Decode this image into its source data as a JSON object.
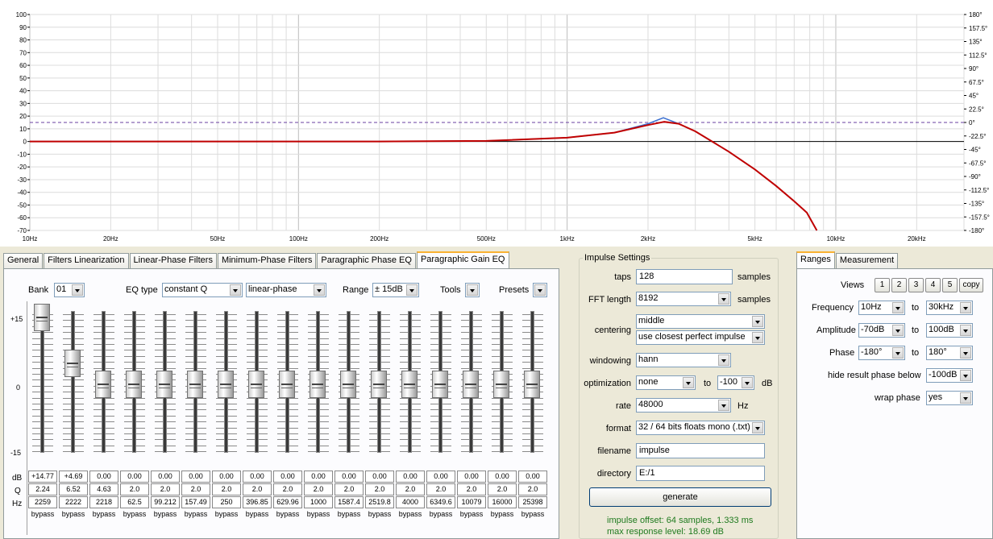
{
  "plot": {
    "y_left_ticks": [
      "100",
      "90",
      "80",
      "70",
      "60",
      "50",
      "40",
      "30",
      "20",
      "10",
      "0",
      "-10",
      "-20",
      "-30",
      "-40",
      "-50",
      "-60",
      "-70"
    ],
    "y_right_ticks": [
      "180°",
      "157.5°",
      "135°",
      "112.5°",
      "90°",
      "67.5°",
      "45°",
      "22.5°",
      "0°",
      "-22.5°",
      "-45°",
      "-67.5°",
      "-90°",
      "-112.5°",
      "-135°",
      "-157.5°",
      "-180°"
    ],
    "x_ticks": [
      {
        "label": "10Hz",
        "f": 10
      },
      {
        "label": "20Hz",
        "f": 20
      },
      {
        "label": "50Hz",
        "f": 50
      },
      {
        "label": "100Hz",
        "f": 100
      },
      {
        "label": "200Hz",
        "f": 200
      },
      {
        "label": "500Hz",
        "f": 500
      },
      {
        "label": "1kHz",
        "f": 1000
      },
      {
        "label": "2kHz",
        "f": 2000
      },
      {
        "label": "5kHz",
        "f": 5000
      },
      {
        "label": "10kHz",
        "f": 10000
      },
      {
        "label": "20kHz",
        "f": 20000
      }
    ],
    "colors": {
      "red": "#c00000",
      "blue": "#3a6fd0",
      "dash": "#6a3fa0"
    }
  },
  "chart_data": {
    "type": "line",
    "xlabel": "",
    "ylabel": "",
    "xlim_hz": [
      10,
      30000
    ],
    "ylim_db": [
      -70,
      100
    ],
    "x_scale": "log",
    "phase_range_deg": [
      -180,
      180
    ],
    "series": [
      {
        "name": "",
        "color": "#c00000",
        "points": [
          [
            10,
            0
          ],
          [
            200,
            0
          ],
          [
            500,
            0.5
          ],
          [
            1000,
            3
          ],
          [
            1500,
            7
          ],
          [
            2000,
            13
          ],
          [
            2300,
            15.5
          ],
          [
            2600,
            14
          ],
          [
            3000,
            8
          ],
          [
            4000,
            -8
          ],
          [
            5000,
            -22
          ],
          [
            6000,
            -35
          ],
          [
            7000,
            -47
          ],
          [
            7800,
            -56
          ],
          [
            8500,
            -70
          ]
        ]
      },
      {
        "name": "",
        "color": "#3a6fd0",
        "points": [
          [
            10,
            0
          ],
          [
            200,
            0
          ],
          [
            500,
            0.5
          ],
          [
            1000,
            3
          ],
          [
            1500,
            7
          ],
          [
            2000,
            14
          ],
          [
            2280,
            18.7
          ],
          [
            2600,
            14
          ],
          [
            3000,
            8
          ],
          [
            4000,
            -8
          ],
          [
            5000,
            -22
          ],
          [
            6000,
            -35
          ],
          [
            7000,
            -47
          ],
          [
            7800,
            -56
          ],
          [
            8500,
            -70
          ]
        ]
      }
    ],
    "reference_lines": [
      {
        "y_db": 0,
        "style": "solid",
        "color": "#000000"
      },
      {
        "y_db": 15,
        "style": "dashed",
        "color": "#6a3fa0"
      }
    ]
  },
  "left_tabs": [
    "General",
    "Filters Linearization",
    "Linear-Phase Filters",
    "Minimum-Phase Filters",
    "Paragraphic Phase EQ",
    "Paragraphic Gain EQ"
  ],
  "eq": {
    "bank_label": "Bank",
    "bank_value": "01",
    "eqtype_label": "EQ type",
    "eqtype_value": "constant Q",
    "phase_value": "linear-phase",
    "range_label": "Range",
    "range_value": "± 15dB",
    "tools_label": "Tools",
    "presets_label": "Presets",
    "scale_top": "+15",
    "scale_mid": "0",
    "scale_bot": "-15",
    "row_db": "dB",
    "row_q": "Q",
    "row_hz": "Hz",
    "bands": [
      {
        "db": "+14.77",
        "q": "2.24",
        "hz": "2259",
        "bypass": "bypass",
        "level": 14.77
      },
      {
        "db": "+4.69",
        "q": "6.52",
        "hz": "2222",
        "bypass": "bypass",
        "level": 4.69
      },
      {
        "db": "0.00",
        "q": "4.63",
        "hz": "2218",
        "bypass": "bypass",
        "level": 0
      },
      {
        "db": "0.00",
        "q": "2.0",
        "hz": "62.5",
        "bypass": "bypass",
        "level": 0
      },
      {
        "db": "0.00",
        "q": "2.0",
        "hz": "99.212",
        "bypass": "bypass",
        "level": 0
      },
      {
        "db": "0.00",
        "q": "2.0",
        "hz": "157.49",
        "bypass": "bypass",
        "level": 0
      },
      {
        "db": "0.00",
        "q": "2.0",
        "hz": "250",
        "bypass": "bypass",
        "level": 0
      },
      {
        "db": "0.00",
        "q": "2.0",
        "hz": "396.85",
        "bypass": "bypass",
        "level": 0
      },
      {
        "db": "0.00",
        "q": "2.0",
        "hz": "629.96",
        "bypass": "bypass",
        "level": 0
      },
      {
        "db": "0.00",
        "q": "2.0",
        "hz": "1000",
        "bypass": "bypass",
        "level": 0
      },
      {
        "db": "0.00",
        "q": "2.0",
        "hz": "1587.4",
        "bypass": "bypass",
        "level": 0
      },
      {
        "db": "0.00",
        "q": "2.0",
        "hz": "2519.8",
        "bypass": "bypass",
        "level": 0
      },
      {
        "db": "0.00",
        "q": "2.0",
        "hz": "4000",
        "bypass": "bypass",
        "level": 0
      },
      {
        "db": "0.00",
        "q": "2.0",
        "hz": "6349.6",
        "bypass": "bypass",
        "level": 0
      },
      {
        "db": "0.00",
        "q": "2.0",
        "hz": "10079",
        "bypass": "bypass",
        "level": 0
      },
      {
        "db": "0.00",
        "q": "2.0",
        "hz": "16000",
        "bypass": "bypass",
        "level": 0
      },
      {
        "db": "0.00",
        "q": "2.0",
        "hz": "25398",
        "bypass": "bypass",
        "level": 0
      }
    ]
  },
  "impulse": {
    "title": "Impulse Settings",
    "taps_label": "taps",
    "taps_value": "128",
    "taps_unit": "samples",
    "fft_label": "FFT length",
    "fft_value": "8192",
    "fft_unit": "samples",
    "centering_label": "centering",
    "centering_value": "middle",
    "centering_value2": "use closest perfect impulse",
    "windowing_label": "windowing",
    "windowing_value": "hann",
    "optimization_label": "optimization",
    "optimization_value": "none",
    "to_label": "to",
    "opt_to_value": "-100",
    "opt_unit": "dB",
    "rate_label": "rate",
    "rate_value": "48000",
    "rate_unit": "Hz",
    "format_label": "format",
    "format_value": "32 / 64 bits floats mono (.txt)",
    "filename_label": "filename",
    "filename_value": "impulse",
    "directory_label": "directory",
    "directory_value": "E:/1",
    "generate_label": "generate",
    "status_offset": "impulse offset: 64 samples, 1.333 ms",
    "status_level": "max response level: 18.69 dB"
  },
  "ranges": {
    "tabs": [
      "Ranges",
      "Measurement"
    ],
    "views_label": "Views",
    "views": [
      "1",
      "2",
      "3",
      "4",
      "5"
    ],
    "copy_label": "copy",
    "frequency_label": "Frequency",
    "freq_from": "10Hz",
    "freq_to": "30kHz",
    "amplitude_label": "Amplitude",
    "amp_from": "-70dB",
    "amp_to": "100dB",
    "phase_label": "Phase",
    "phase_from": "-180°",
    "phase_to": "180°",
    "to_label": "to",
    "hide_label": "hide result phase below",
    "hide_value": "-100dB",
    "wrap_label": "wrap phase",
    "wrap_value": "yes"
  }
}
